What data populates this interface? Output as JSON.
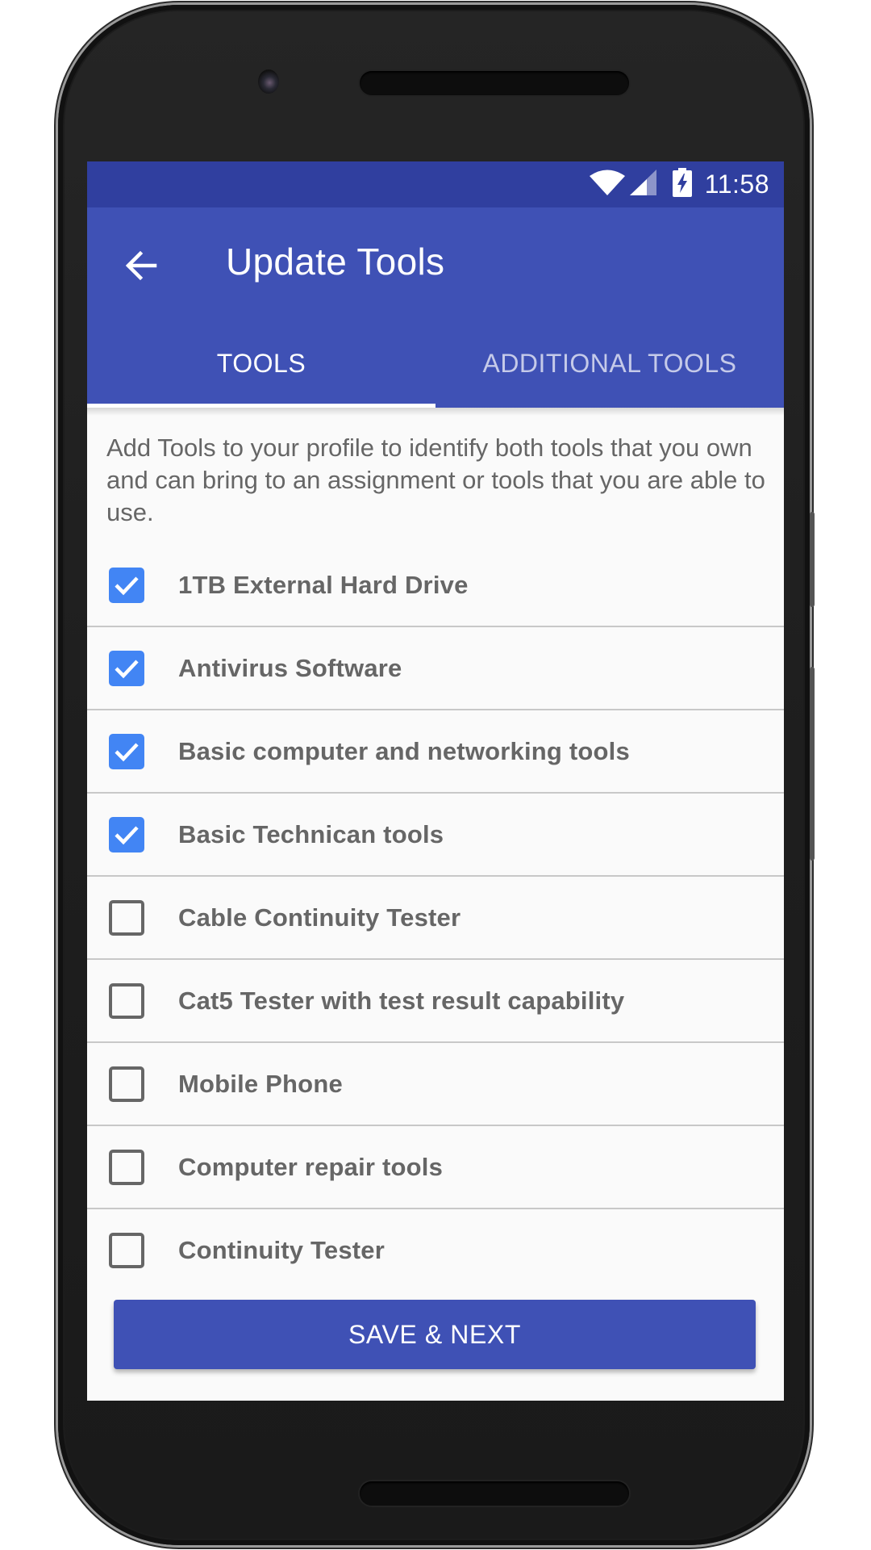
{
  "status_bar": {
    "time": "11:58",
    "icons": [
      "wifi-icon",
      "cell-signal-icon",
      "battery-charging-icon"
    ]
  },
  "app_bar": {
    "back_icon": "arrow-left-icon",
    "title": "Update Tools"
  },
  "tabs": [
    {
      "label": "TOOLS",
      "active": true
    },
    {
      "label": "ADDITIONAL TOOLS",
      "active": false
    }
  ],
  "description": "Add Tools to your profile to identify both tools that you own and can bring to an assignment or tools that you are able to use.",
  "tools": [
    {
      "label": "1TB External Hard Drive",
      "checked": true
    },
    {
      "label": "Antivirus Software",
      "checked": true
    },
    {
      "label": "Basic computer and networking tools",
      "checked": true
    },
    {
      "label": "Basic Technican tools",
      "checked": true
    },
    {
      "label": "Cable Continuity Tester",
      "checked": false
    },
    {
      "label": "Cat5 Tester with test result capability",
      "checked": false
    },
    {
      "label": "Mobile Phone",
      "checked": false
    },
    {
      "label": "Computer repair tools",
      "checked": false
    },
    {
      "label": "Continuity Tester",
      "checked": false
    }
  ],
  "save_button": {
    "label": "SAVE & NEXT"
  },
  "colors": {
    "primary": "#3f51b5",
    "primary_dark": "#303f9f",
    "checkbox_checked": "#4285f4",
    "text_secondary": "#666666",
    "tab_inactive": "#c5cae9"
  }
}
